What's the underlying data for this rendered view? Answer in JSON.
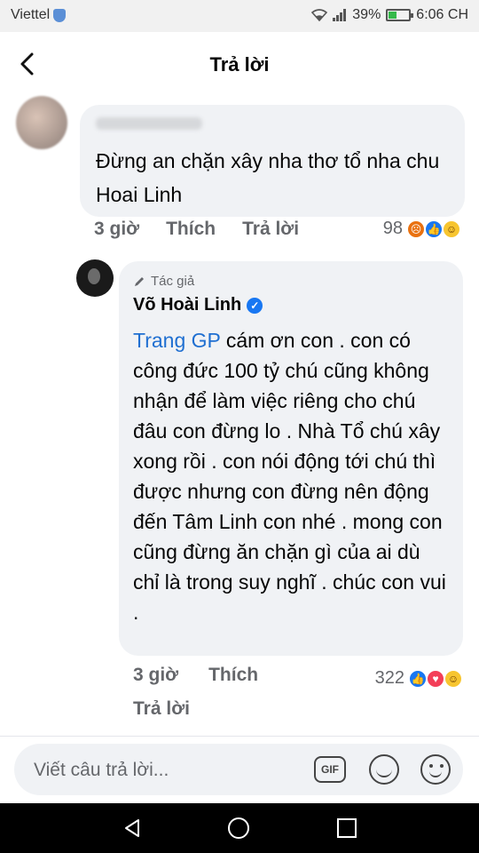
{
  "status_bar": {
    "carrier": "Viettel",
    "battery": "39%",
    "battery_level": 0.39,
    "time": "6:06 CH"
  },
  "header": {
    "title": "Trả lời"
  },
  "comment": {
    "text": "Đừng an chặn xây nha thơ tổ nha chu Hoai Linh",
    "time": "3 giờ",
    "like_label": "Thích",
    "reply_label": "Trả lời",
    "reaction_count": "98",
    "reactions": [
      "angry-icon",
      "like-icon",
      "haha-icon"
    ]
  },
  "reply": {
    "author_tag": "Tác giả",
    "author_name": "Võ Hoài Linh",
    "mention": "Trang GP",
    "text": " cám ơn con . con có công đức 100 tỷ chú cũng không nhận để làm việc riêng cho chú đâu con đừng lo . Nhà Tổ chú xây xong rồi . con nói động tới chú thì được nhưng con đừng nên động đến Tâm Linh con nhé . mong con cũng đừng ăn chặn gì của ai dù chỉ là trong suy nghĩ . chúc con vui .",
    "time": "3 giờ",
    "like_label": "Thích",
    "reply_label": "Trả lời",
    "reaction_count": "322",
    "reactions": [
      "like-icon",
      "love-icon",
      "care-icon"
    ]
  },
  "composer": {
    "placeholder": "Viết câu trả lời...",
    "gif_label": "GIF"
  }
}
